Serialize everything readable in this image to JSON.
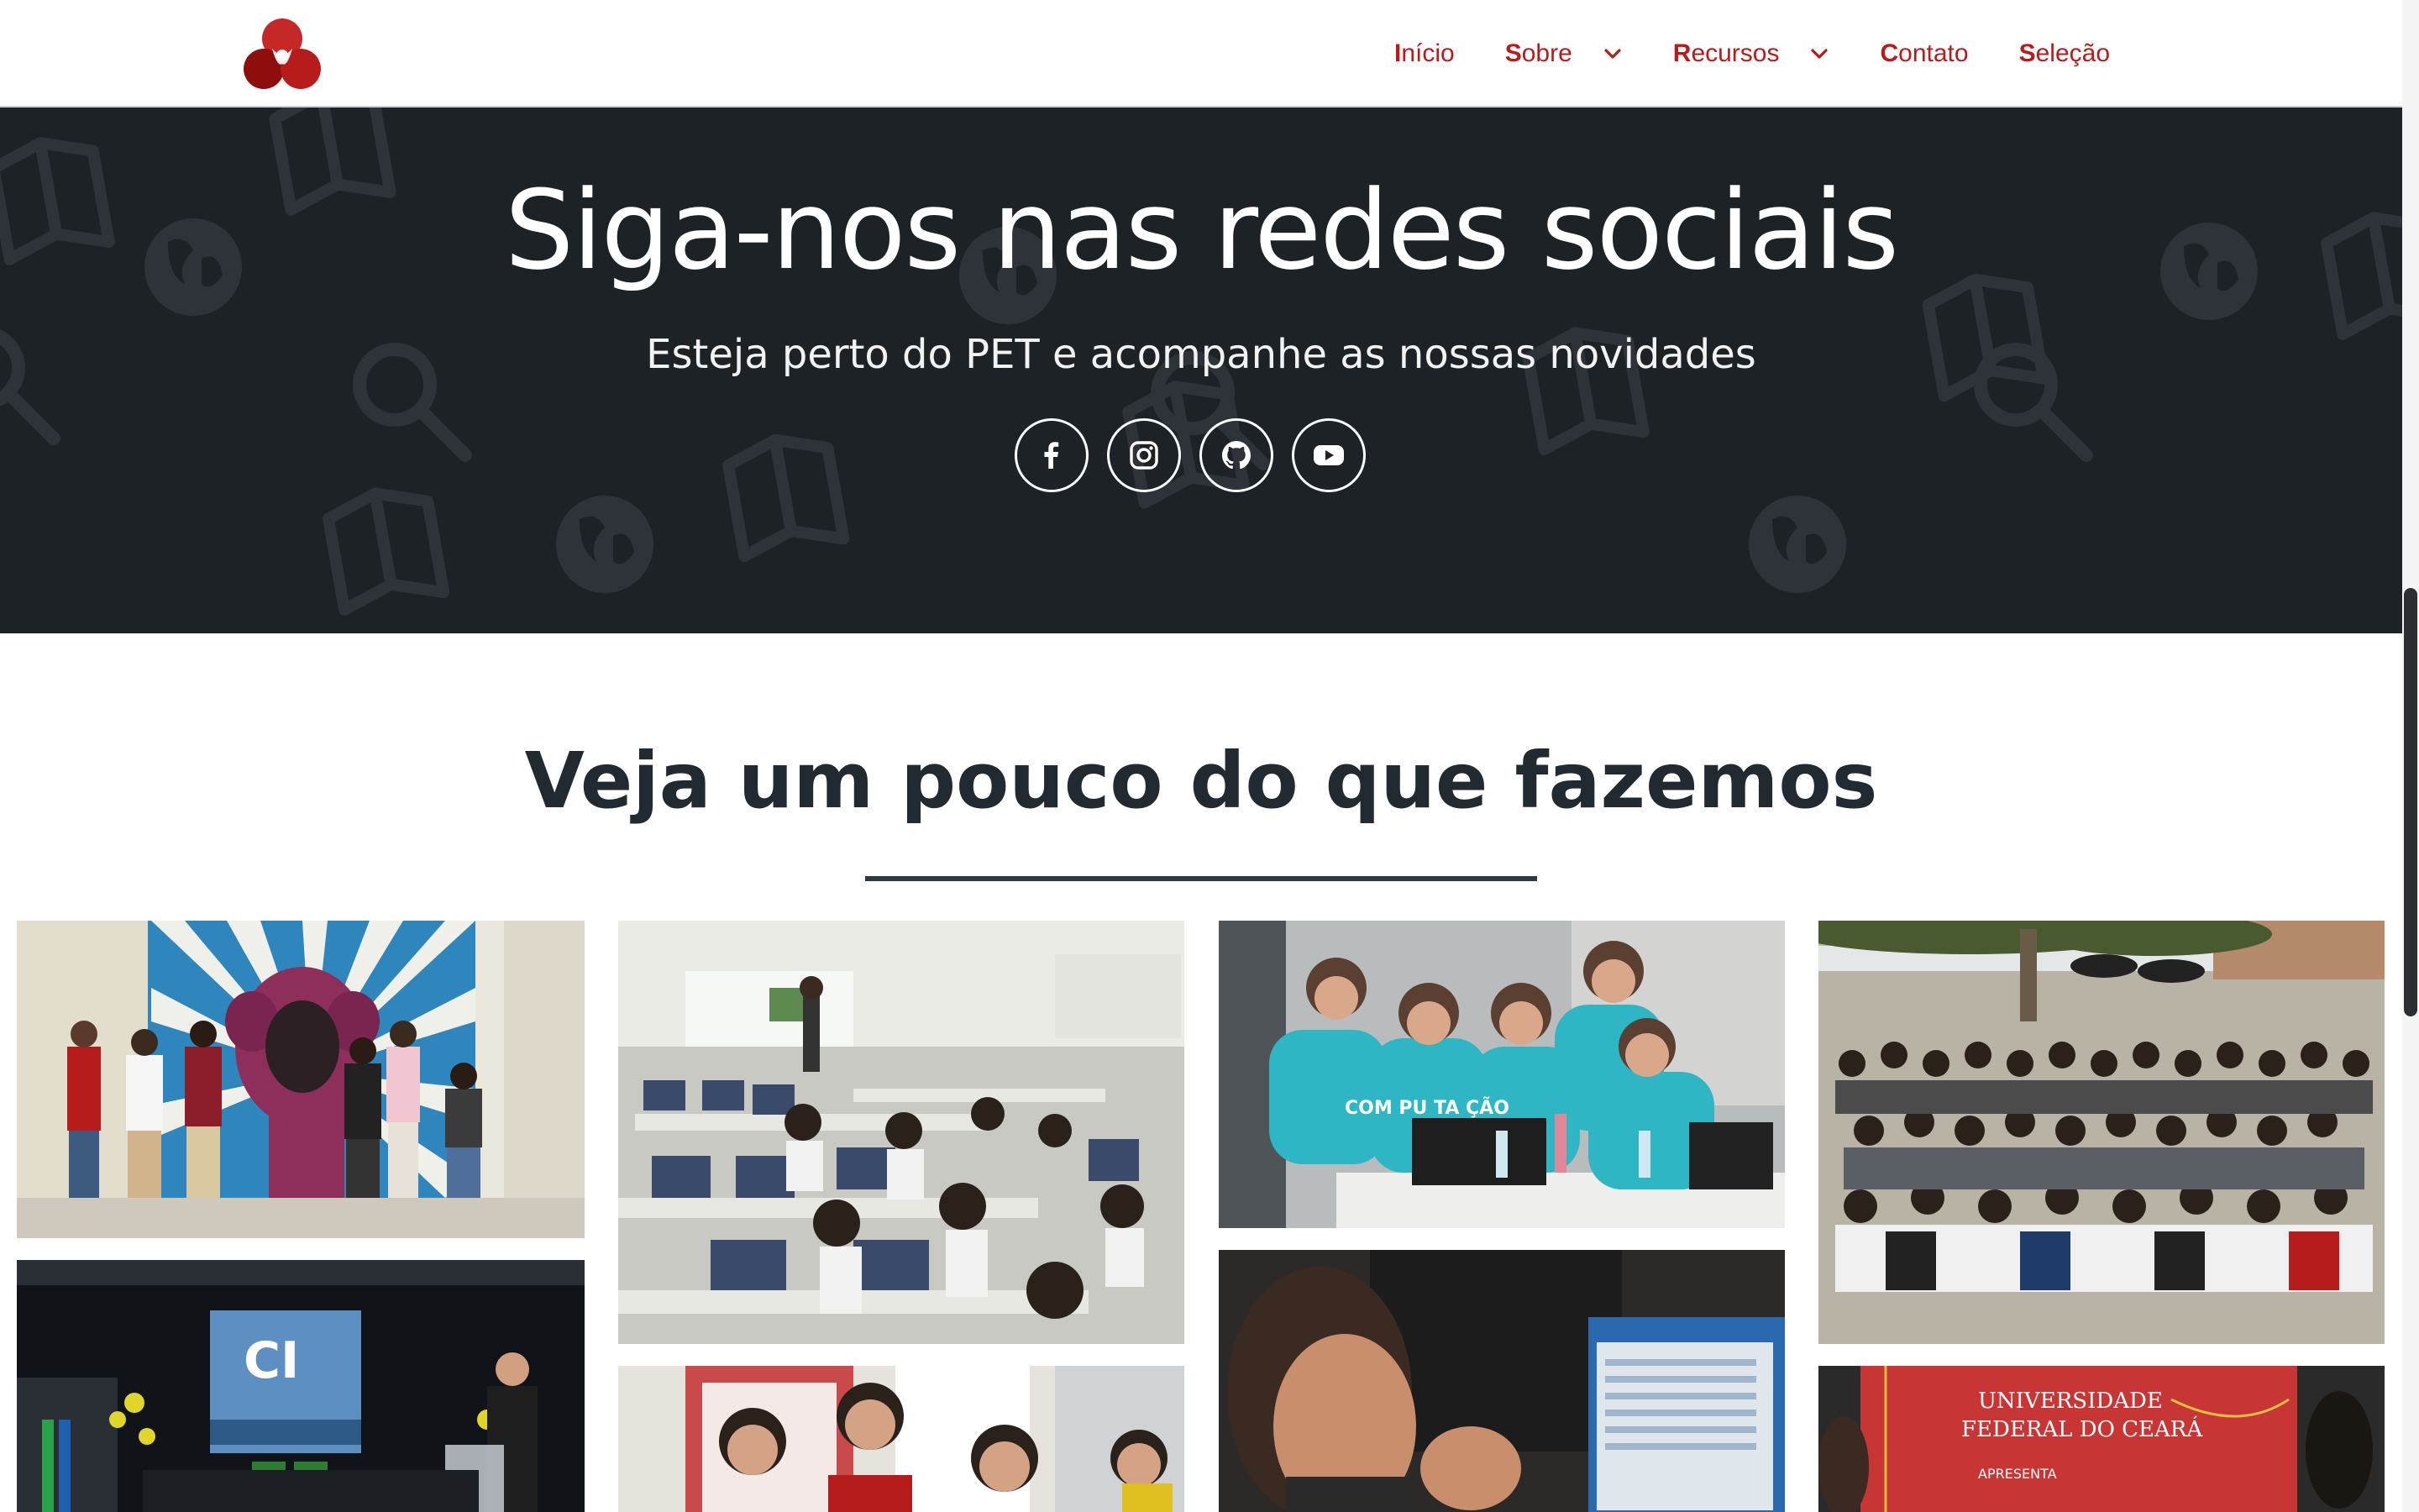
{
  "nav": {
    "logo_icon": "pet-logo-icon",
    "items": [
      {
        "first": "I",
        "rest": "nício",
        "dropdown": false
      },
      {
        "first": "S",
        "rest": "obre",
        "dropdown": true
      },
      {
        "first": "R",
        "rest": "ecursos",
        "dropdown": true
      },
      {
        "first": "C",
        "rest": "ontato",
        "dropdown": false
      },
      {
        "first": "S",
        "rest": "eleção",
        "dropdown": false
      }
    ]
  },
  "hero": {
    "title": "Siga-nos nas redes sociais",
    "subtitle": "Esteja perto do PET e acompanhe as nossas novidades",
    "socials": [
      "facebook-icon",
      "instagram-icon",
      "github-icon",
      "youtube-icon"
    ]
  },
  "section": {
    "title_first": "V",
    "title_rest": "eja um pouco do que fazemos"
  },
  "gallery": {
    "photo_texts": {
      "event_banner": "CI",
      "shirt": "COM PU TA ÇÃO",
      "ufc_line1": "UNIVERSIDADE",
      "ufc_line2": "FEDERAL DO CEARÁ",
      "ufc_line3": "APRESENTA"
    }
  },
  "colors": {
    "accent": "#b71c1c",
    "hero_bg": "#1d2226",
    "heading": "#222a31"
  }
}
